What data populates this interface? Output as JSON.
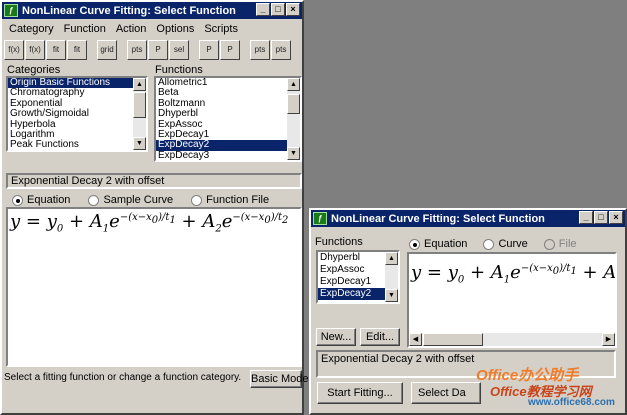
{
  "main": {
    "title": "NonLinear Curve Fitting:  Select Function",
    "menu": [
      "Category",
      "Function",
      "Action",
      "Options",
      "Scripts"
    ],
    "tool_labels": [
      "f(x)",
      "f(x)",
      "fit",
      "fit",
      "grid",
      "pts",
      "P",
      "sel",
      "P",
      "P",
      "pts",
      "pts"
    ],
    "categories_label": "Categories",
    "categories": [
      "Origin Basic Functions",
      "Chromatography",
      "Exponential",
      "Growth/Sigmoidal",
      "Hyperbola",
      "Logarithm",
      "Peak Functions"
    ],
    "functions_label": "Functions",
    "functions": [
      "Allometric1",
      "Beta",
      "Boltzmann",
      "Dhyperbl",
      "ExpAssoc",
      "ExpDecay1",
      "ExpDecay2",
      "ExpDecay3"
    ],
    "description": "Exponential Decay 2 with offset",
    "tabs": [
      "Equation",
      "Sample Curve",
      "Function File"
    ],
    "status": "Select a fitting function or change a function category.",
    "basic_mode_label": "Basic Mode"
  },
  "second": {
    "title": "NonLinear Curve Fitting:  Select Function",
    "functions_label": "Functions",
    "functions": [
      "Dhyperbl",
      "ExpAssoc",
      "ExpDecay1",
      "ExpDecay2"
    ],
    "tabs": [
      "Equation",
      "Curve",
      "File"
    ],
    "new_label": "New...",
    "edit_label": "Edit...",
    "description": "Exponential Decay 2 with offset",
    "start_fitting_label": "Start Fitting...",
    "select_label": "Select Da"
  },
  "watermark": {
    "line1": "Office办公助手",
    "line2": "Office教程学习网",
    "url": "www.office68.com"
  },
  "colors": {
    "title_bar": "#0a246a",
    "selection": "#0a246a",
    "face": "#d4d0c8",
    "icon_green": "#1a7a1a"
  }
}
